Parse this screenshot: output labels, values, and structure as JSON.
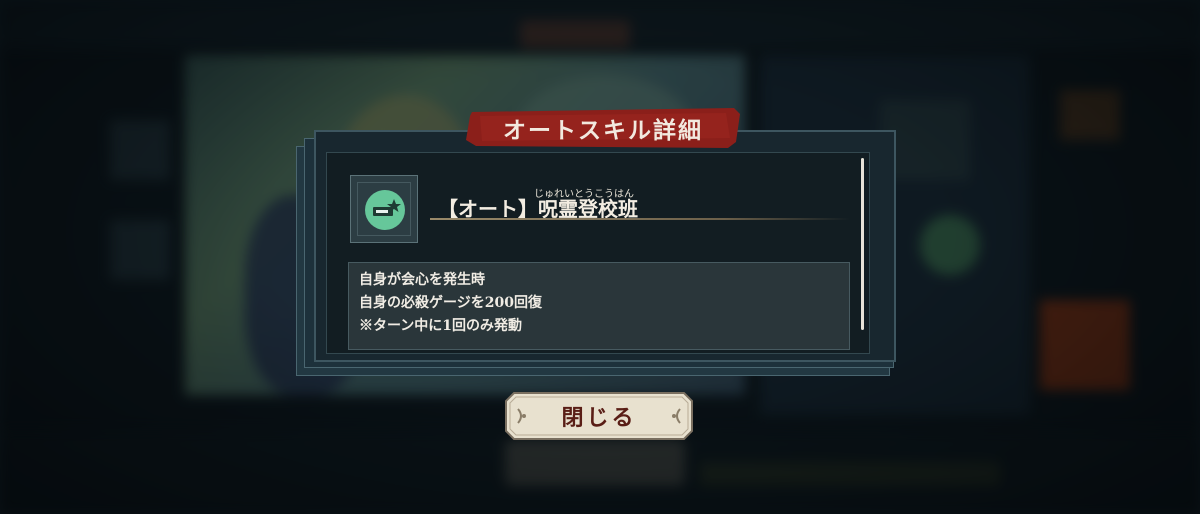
{
  "dialog": {
    "title": "オートスキル詳細",
    "skill": {
      "ruby": "じゅれいとうこうはん",
      "name": "【オート】呪霊登校班",
      "icon": "skill-card-star-icon",
      "icon_color": "#66c79a"
    },
    "description": [
      "自身が会心を発生時",
      "自身の必殺ゲージを200回復",
      "※ターン中に1回のみ発動"
    ]
  },
  "close_button": {
    "label": "閉じる"
  },
  "colors": {
    "banner": "#8b1f1a",
    "button_face": "#e8e1cf",
    "button_text": "#5a1e16"
  }
}
